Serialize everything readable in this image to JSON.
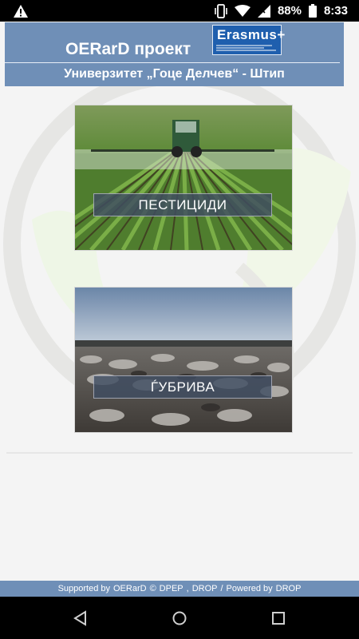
{
  "status_bar": {
    "left_icon": "warning-triangle-icon",
    "icons": [
      "vibrate-icon",
      "wifi-icon",
      "signal-icon",
      "battery-icon"
    ],
    "battery": "88%",
    "time": "8:33"
  },
  "header": {
    "title": "OERarD проект",
    "logo_text": "Erasmus+",
    "subtitle": "Универзитет „Гоце Делчев“ - Штип"
  },
  "cards": [
    {
      "label": "ПЕСТИЦИДИ",
      "image": "tractor-spraying-field-photo"
    },
    {
      "label": "ЃУБРИВА",
      "image": "rocky-field-photo"
    }
  ],
  "footer": {
    "supported_by": "Supported by",
    "org1": "OERarD",
    "copyright": "©",
    "org2": "DPEP",
    "comma": ",",
    "org3": "DROP",
    "slash": "/",
    "powered_by": "Powered by",
    "org4": "DROP"
  },
  "nav_bar": {
    "items": [
      "back-icon",
      "home-icon",
      "recents-icon"
    ]
  },
  "colors": {
    "header": "#6f8fb7",
    "label_bg": "#3f4d62",
    "erasmus": "#1f5fae"
  }
}
